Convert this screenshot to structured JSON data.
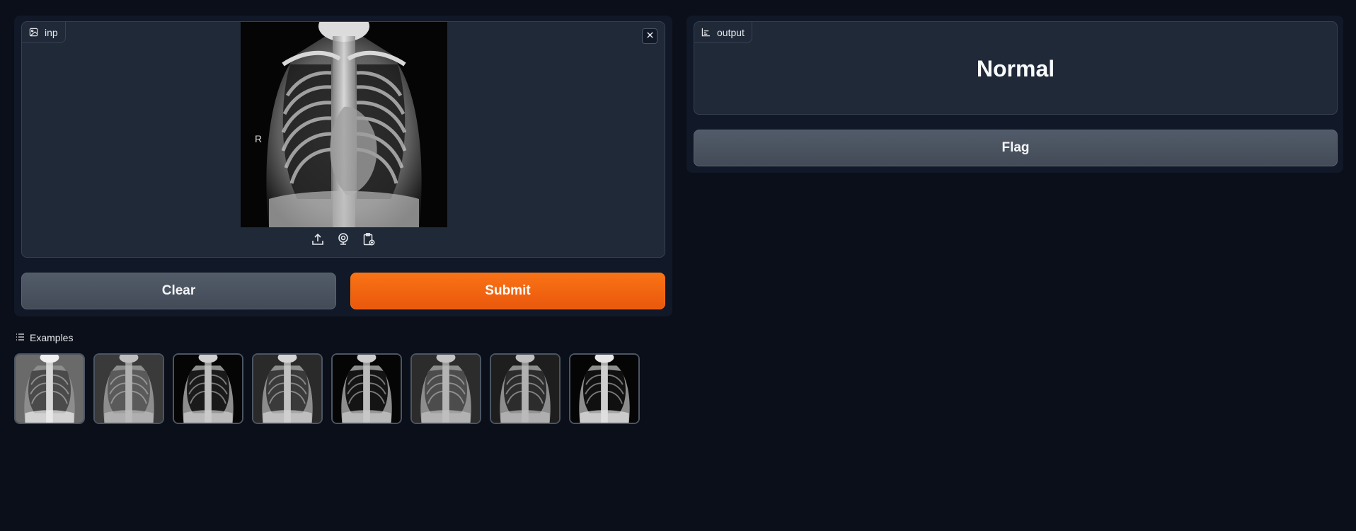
{
  "input": {
    "label": "inp",
    "image_marker": "R",
    "toolbar_icons": [
      "upload-icon",
      "webcam-icon",
      "clipboard-icon"
    ]
  },
  "buttons": {
    "clear": "Clear",
    "submit": "Submit",
    "flag": "Flag"
  },
  "output": {
    "label": "output",
    "value": "Normal"
  },
  "examples": {
    "label": "Examples",
    "count": 8
  },
  "colors": {
    "background": "#0b0f19",
    "panel": "#111827",
    "block": "#1f2937",
    "accent": "#f97316",
    "secondary_button": "#4b5563"
  }
}
